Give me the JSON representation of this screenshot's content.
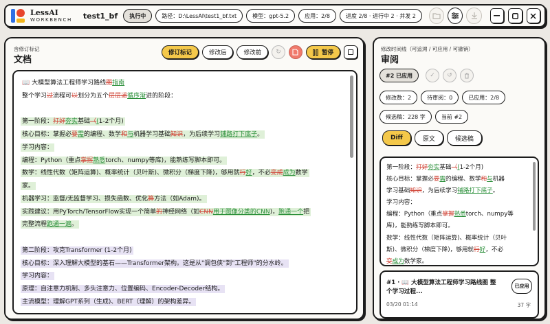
{
  "app": {
    "name": "LessAI",
    "subtitle": "WORKBENCH"
  },
  "topbar": {
    "doc_name": "test1_bf",
    "status": "执行中",
    "path": "路径：D:\\LessAI\\test1_bf.txt",
    "model": "模型：gpt-5.2",
    "applied": "应用：2/8",
    "progress": "进度 2/8 · 进行中 2 · 并发 2"
  },
  "left": {
    "small": "含修订标记",
    "title": "文档",
    "buttons": {
      "markup": "修订标记",
      "after": "修改后",
      "before": "修改前",
      "pause": "暂停"
    }
  },
  "doc_lines": [
    {
      "bg": "",
      "segs": [
        {
          "t": "📖 大模型算法工程师学习路线"
        },
        {
          "t": "图",
          "k": "del"
        },
        {
          "t": "指南",
          "k": "ins"
        }
      ]
    },
    {
      "bg": "",
      "segs": [
        {
          "t": "整个学习"
        },
        {
          "t": "过",
          "k": "del"
        },
        {
          "t": "流程可"
        },
        {
          "t": "以",
          "k": "del"
        },
        {
          "t": "划分为五个"
        },
        {
          "t": "层层递",
          "k": "del"
        },
        {
          "t": "循序渐",
          "k": "ins"
        },
        {
          "t": "进的阶段："
        }
      ]
    },
    {
      "bg": "",
      "segs": [
        {
          "t": ""
        }
      ]
    },
    {
      "bg": "g",
      "segs": [
        {
          "t": "第一阶段："
        },
        {
          "t": "打好",
          "k": "del"
        },
        {
          "t": "夯实",
          "k": "ins"
        },
        {
          "t": "基础"
        },
        {
          "t": "（",
          "k": "del"
        },
        {
          "t": "(",
          "k": "ins"
        },
        {
          "t": "1-2个月)"
        }
      ]
    },
    {
      "bg": "g",
      "segs": [
        {
          "t": "核心目标：掌握必"
        },
        {
          "t": "要",
          "k": "del"
        },
        {
          "t": "需",
          "k": "ins"
        },
        {
          "t": "的编程、数学"
        },
        {
          "t": "和",
          "k": "del"
        },
        {
          "t": "与",
          "k": "ins"
        },
        {
          "t": "机器学习基础"
        },
        {
          "t": "知识",
          "k": "del"
        },
        {
          "t": "，为后续学习"
        },
        {
          "t": "铺路",
          "k": "ins"
        },
        {
          "t": "打下底子",
          "k": "ins"
        },
        {
          "t": "。"
        }
      ]
    },
    {
      "bg": "g",
      "segs": [
        {
          "t": "学习内容："
        }
      ]
    },
    {
      "bg": "g",
      "segs": [
        {
          "t": "编程：Python（重点"
        },
        {
          "t": "掌握",
          "k": "del"
        },
        {
          "t": "熟悉",
          "k": "ins"
        },
        {
          "t": "torch、numpy等库)，能熟练写脚本即可。"
        }
      ]
    },
    {
      "bg": "g",
      "segs": [
        {
          "t": "数学：线性代数（矩阵运算)、概率统计（贝叶斯)、微积分（梯度下降)，够用就"
        },
        {
          "t": "行",
          "k": "del"
        },
        {
          "t": "好",
          "k": "ins"
        },
        {
          "t": "，不必"
        },
        {
          "t": "变成",
          "k": "del"
        },
        {
          "t": "成为",
          "k": "ins"
        },
        {
          "t": "数学"
        }
      ]
    },
    {
      "bg": "g",
      "segs": [
        {
          "t": "家。"
        }
      ]
    },
    {
      "bg": "g",
      "segs": [
        {
          "t": "机器学习：监督/无监督学习、损失函数、优化"
        },
        {
          "t": "算",
          "k": "del"
        },
        {
          "t": "方法（如Adam)。"
        }
      ]
    },
    {
      "bg": "g",
      "segs": [
        {
          "t": "实践建议：用PyTorch/TensorFlow实现一个简单"
        },
        {
          "t": "的",
          "k": "del"
        },
        {
          "t": "神经网络（如"
        },
        {
          "t": "CNN",
          "k": "del"
        },
        {
          "t": "用于图像分类的CNN",
          "k": "ins"
        },
        {
          "t": ")，"
        },
        {
          "t": "跑通一个",
          "k": "ins"
        },
        {
          "t": "把"
        }
      ]
    },
    {
      "bg": "g",
      "segs": [
        {
          "t": "完整流程"
        },
        {
          "t": "跑通一遍",
          "k": "ins"
        },
        {
          "t": "。"
        }
      ]
    },
    {
      "bg": "",
      "segs": [
        {
          "t": ""
        }
      ]
    },
    {
      "bg": "v",
      "segs": [
        {
          "t": "第二阶段：攻克Transformer (1-2个月)"
        }
      ]
    },
    {
      "bg": "v",
      "segs": [
        {
          "t": "核心目标：深入理解大模型的基石——Transformer架构。这是从\"调包侠\"到\"工程师\"的分水岭。"
        }
      ]
    },
    {
      "bg": "v",
      "segs": [
        {
          "t": "学习内容："
        }
      ]
    },
    {
      "bg": "v",
      "segs": [
        {
          "t": "原理：自注意力机制、多头注意力、位置编码、Encoder-Decoder结构。"
        }
      ]
    },
    {
      "bg": "v",
      "segs": [
        {
          "t": "主流模型：理解GPT系列（生成)、BERT（理解）的架构差异。"
        }
      ]
    }
  ],
  "right": {
    "small": "修改时间线（可追溯 / 可应用 / 可撤销）",
    "title": "审阅",
    "current_badge": "#2 已应用",
    "stats": {
      "modified": "修改数：2",
      "pending": "待审阅：0",
      "applied": "已应用：2/8",
      "candidate": "候选稿：228 字",
      "current": "当前 #2"
    },
    "tabs": {
      "diff": "Diff",
      "original": "原文",
      "candidate": "候选稿"
    }
  },
  "diff_lines": [
    {
      "segs": [
        {
          "t": "第一阶段："
        },
        {
          "t": "打好",
          "k": "del"
        },
        {
          "t": "夯实",
          "k": "ins"
        },
        {
          "t": "基础"
        },
        {
          "t": "（",
          "k": "del"
        },
        {
          "t": "(",
          "k": "ins"
        },
        {
          "t": "1-2个月)"
        }
      ]
    },
    {
      "segs": [
        {
          "t": "核心目标：掌握必"
        },
        {
          "t": "要",
          "k": "del"
        },
        {
          "t": "需",
          "k": "ins"
        },
        {
          "t": "的编程、数学"
        },
        {
          "t": "和",
          "k": "del"
        },
        {
          "t": "与",
          "k": "ins"
        },
        {
          "t": "机器"
        }
      ]
    },
    {
      "segs": [
        {
          "t": "学习基础"
        },
        {
          "t": "知识",
          "k": "del"
        },
        {
          "t": "，为后续学习"
        },
        {
          "t": "铺路",
          "k": "ins"
        },
        {
          "t": "打下底子",
          "k": "ins"
        },
        {
          "t": "。"
        }
      ]
    },
    {
      "segs": [
        {
          "t": "学习内容："
        }
      ]
    },
    {
      "segs": [
        {
          "t": "编程：Python（重点"
        },
        {
          "t": "掌握",
          "k": "del"
        },
        {
          "t": "熟悉",
          "k": "ins"
        },
        {
          "t": "torch、numpy等"
        }
      ]
    },
    {
      "segs": [
        {
          "t": "库)，能熟练写脚本即可。"
        }
      ]
    },
    {
      "segs": [
        {
          "t": "数学：线性代数（矩阵运算)、概率统计（贝叶"
        }
      ]
    },
    {
      "segs": [
        {
          "t": "斯)、微积分（梯度下降)，够用就"
        },
        {
          "t": "行",
          "k": "del"
        },
        {
          "t": "好",
          "k": "ins"
        },
        {
          "t": "，不必"
        }
      ]
    },
    {
      "segs": [
        {
          "t": "变",
          "k": "del"
        },
        {
          "t": "成",
          "k": "ins"
        },
        {
          "t": "为",
          "k": "ins"
        },
        {
          "t": "数学家。"
        }
      ]
    }
  ],
  "card": {
    "title": "#1 · 📖 大模型算法工程师学习路线图 整个学习过程...",
    "badge": "已应用",
    "time": "03/20 01:14",
    "length": "37 字"
  }
}
